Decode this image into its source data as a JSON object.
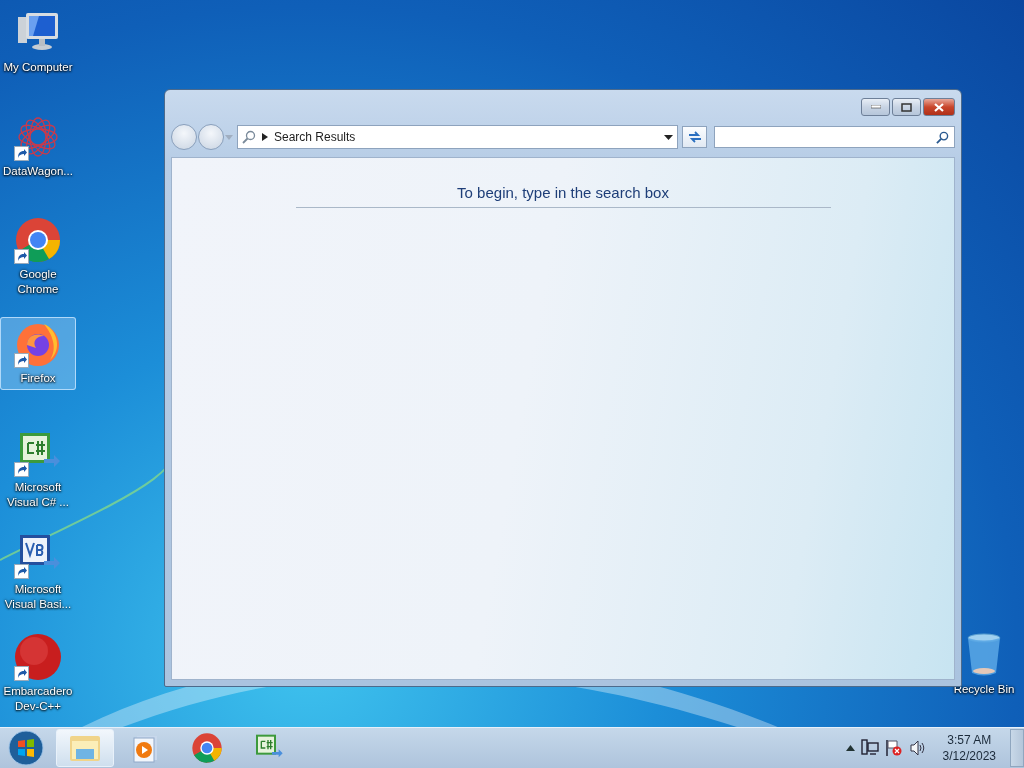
{
  "desktop": {
    "icons": [
      {
        "label": "My Computer",
        "shortcut": false,
        "selected": false
      },
      {
        "label": "DataWagon...",
        "shortcut": true,
        "selected": false
      },
      {
        "label": "Google Chrome",
        "shortcut": true,
        "selected": false
      },
      {
        "label": "Firefox",
        "shortcut": true,
        "selected": true
      },
      {
        "label": "Microsoft Visual C# ...",
        "shortcut": true,
        "selected": false
      },
      {
        "label": "Microsoft Visual Basi...",
        "shortcut": true,
        "selected": false
      },
      {
        "label": "Embarcadero Dev-C++",
        "shortcut": true,
        "selected": false
      },
      {
        "label": "Recycle Bin",
        "shortcut": false,
        "selected": false
      }
    ]
  },
  "window": {
    "address": {
      "breadcrumb": "Search Results"
    },
    "message": "To begin, type in the search box"
  },
  "taskbar": {
    "programs": [
      {
        "selected": true
      },
      {
        "selected": false
      },
      {
        "selected": false
      },
      {
        "selected": false
      }
    ],
    "clock": {
      "time": "3:57 AM",
      "date": "3/12/2023"
    }
  }
}
